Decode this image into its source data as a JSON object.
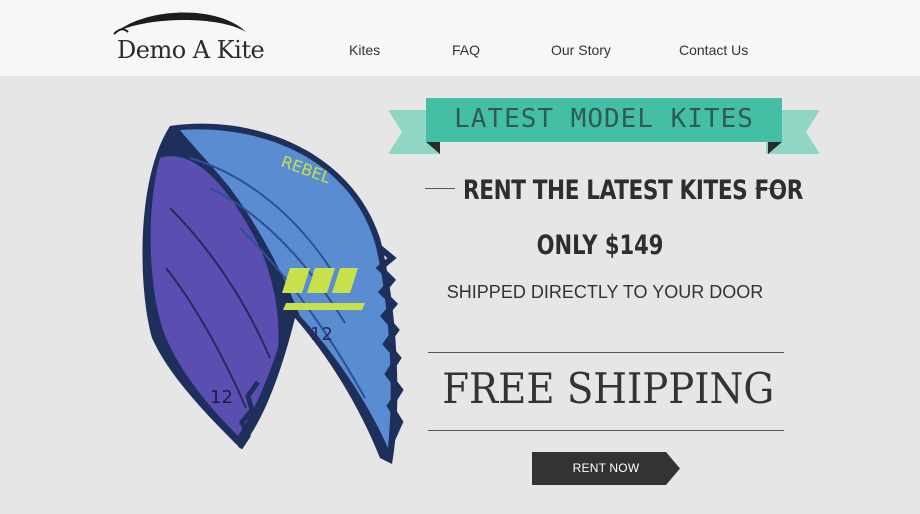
{
  "brand": {
    "name": "Demo A Kite"
  },
  "nav": {
    "items": [
      {
        "label": "Kites"
      },
      {
        "label": "FAQ"
      },
      {
        "label": "Our Story"
      },
      {
        "label": "Contact Us"
      }
    ]
  },
  "hero": {
    "ribbon": "LATEST MODEL KITES",
    "headline": "RENT THE LATEST KITES FOR",
    "price": "ONLY $149",
    "subline": "SHIPPED DIRECTLY TO YOUR DOOR",
    "shipping": "FREE SHIPPING",
    "cta_label": "RENT NOW",
    "kite_print": {
      "model": "REBEL",
      "size": "12"
    }
  },
  "colors": {
    "teal": "#44bfa6",
    "teal_light": "#8fd6c5",
    "cta": "#333333",
    "kite_blue": "#5a8cd2",
    "kite_purple": "#5a4fb0",
    "kite_lime": "#c8e04a"
  }
}
